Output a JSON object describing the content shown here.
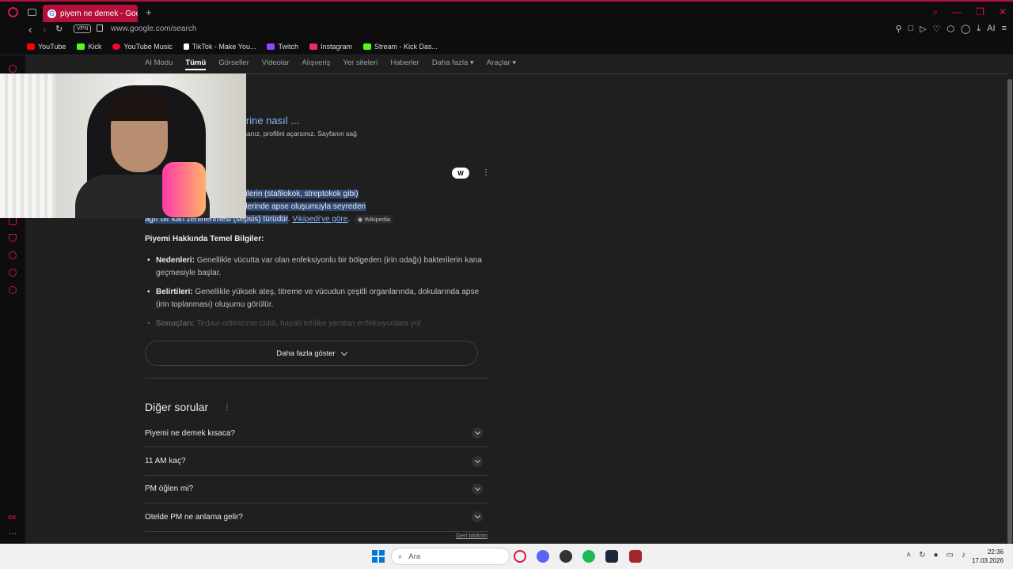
{
  "browser": {
    "tab_title": "piyem ne demek - Google",
    "tab_favicon": "G",
    "new_tab": "+",
    "url": "www.google.com/search",
    "vpn_label": "VPN",
    "ai_label": "AI",
    "bookmarks": [
      "YouTube",
      "Kick",
      "YouTube Music",
      "TikTok - Make You...",
      "Twitch",
      "Instagram",
      "Stream - Kick Das..."
    ],
    "bookmark_colors": [
      "#ff0000",
      "#53fc18",
      "#ff0033",
      "#ffffff",
      "#9146ff",
      "#e1306c",
      "#53fc18"
    ],
    "accent_color": "#c8163f",
    "sidebar_badge": "GX"
  },
  "search_tabs": [
    "AI Modu",
    "Tümü",
    "Görseller",
    "Videolar",
    "Alışveriş",
    "Yer siteleri",
    "Haberler",
    "Daha fazla",
    "Araçlar"
  ],
  "result": {
    "title": "m, pm ne demek ve birine nasıl ...",
    "snippet": "ve bir kişinin kullanıcı adına tıklarsanız, profilini açarsınız. Sayfanın sağ"
  },
  "ai_overview": {
    "line1": "irinli bir odaktan çıkan bakterilerin (stafilokok, streptokok gibi)",
    "line2": "sonucu, vücudun farklı bölgelerinde apse oluşumuyla seyreden",
    "line3": "ağır bir kan zehirlenmesi (sepsis) türüdür",
    "source_link": "Vikipedi'ye göre",
    "source_badge": "Wikipedia",
    "heading": "Piyemi Hakkında Temel Bilgiler:",
    "items": [
      {
        "label": "Nedenleri:",
        "text": "Genellikle vücutta var olan enfeksiyonlu bir bölgeden (irin odağı) bakterilerin kana geçmesiyle başlar."
      },
      {
        "label": "Belirtileri:",
        "text": "Genellikle yüksek ateş, titreme ve vücudun çeşitli organlarında, dokularında apse (irin toplanması) oluşumu görülür."
      },
      {
        "label": "Sonuçları:",
        "text": "Tedavi edilmezse ciddi, hayati tehlike yaratan enfeksiyonlara yol"
      }
    ],
    "more_button": "Daha fazla göster"
  },
  "people_also_ask": {
    "title": "Diğer sorular",
    "questions": [
      "Piyemi ne demek kısaca?",
      "11 AM kaç?",
      "PM öğlen mi?",
      "Otelde PM ne anlama gelir?"
    ],
    "feedback": "Geri bildirim"
  },
  "taskbar": {
    "search_placeholder": "Ara",
    "time": "22:36",
    "date": "17.03.2026"
  }
}
